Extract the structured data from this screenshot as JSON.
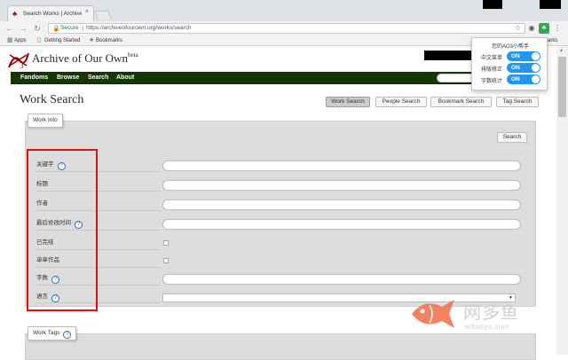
{
  "browser": {
    "tab_title": "Search Works | Archive o",
    "tab_close": "×",
    "secure_label": "Secure",
    "url": "https://archiveofourown.org/works/search"
  },
  "bookmarks": [
    {
      "label": "Apps",
      "icon": "apps-grid-icon"
    },
    {
      "label": "Getting Started",
      "icon": "page-icon"
    },
    {
      "label": "Bookmarks",
      "icon": "star-icon"
    }
  ],
  "bookmarks_truncated": "arks",
  "site": {
    "title": "Archive of Our Own",
    "beta": "beta",
    "logo_color": "#990000",
    "navbar_color": "#143800"
  },
  "nav": [
    "Fandoms",
    "Browse",
    "Search",
    "About"
  ],
  "page": {
    "title": "Work Search",
    "tabs": [
      {
        "label": "Work Search",
        "active": true
      },
      {
        "label": "People Search",
        "active": false
      },
      {
        "label": "Bookmark Search",
        "active": false
      },
      {
        "label": "Tag Search",
        "active": false
      }
    ],
    "fieldset_legend": "Work Info",
    "search_button": "Search",
    "second_legend": "Work Tags",
    "help_glyph": "?"
  },
  "form_rows": [
    {
      "label": "关键字",
      "help": true,
      "control": "text"
    },
    {
      "label": "标题",
      "help": false,
      "control": "text"
    },
    {
      "label": "作者",
      "help": false,
      "control": "text"
    },
    {
      "label": "最后修改时间",
      "help": true,
      "control": "text"
    },
    {
      "label": "已完结",
      "help": false,
      "control": "checkbox"
    },
    {
      "label": "单章作品",
      "help": false,
      "control": "checkbox"
    },
    {
      "label": "字数",
      "help": true,
      "control": "text"
    },
    {
      "label": "语言",
      "help": true,
      "control": "select"
    }
  ],
  "popup": {
    "title": "您的AO3小帮手",
    "toggles": [
      {
        "label": "中文菜单",
        "state": "ON"
      },
      {
        "label": "排版修正",
        "state": "ON"
      },
      {
        "label": "字数统计",
        "state": "ON"
      }
    ],
    "toggle_color": "#2196f3"
  },
  "watermark": {
    "text": "网多鱼",
    "url": "wduoyu.com",
    "fish_color": "#f26b43"
  },
  "highlight_color": "#e01010"
}
